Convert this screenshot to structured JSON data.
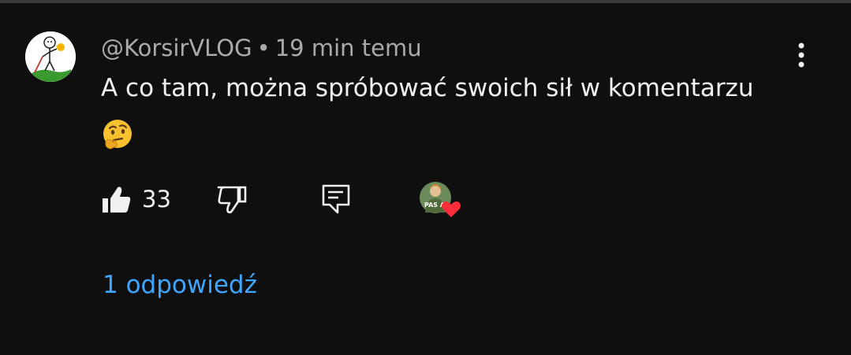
{
  "comment": {
    "author": "@KorsirVLOG",
    "separator": "•",
    "time_ago": "19 min temu",
    "text": "A co tam, można spróbować swoich sił w komentarzu",
    "emoji_icon": "thinking-face-emoji",
    "like_count": "33",
    "replies_label": "1 odpowiedź",
    "creator_avatar_badge": "PAS A"
  },
  "colors": {
    "background": "#0f0f0f",
    "text": "#f1f1f1",
    "secondary_text": "#aaaaaa",
    "link": "#3ea6ff",
    "heart": "#ff2d3a"
  }
}
